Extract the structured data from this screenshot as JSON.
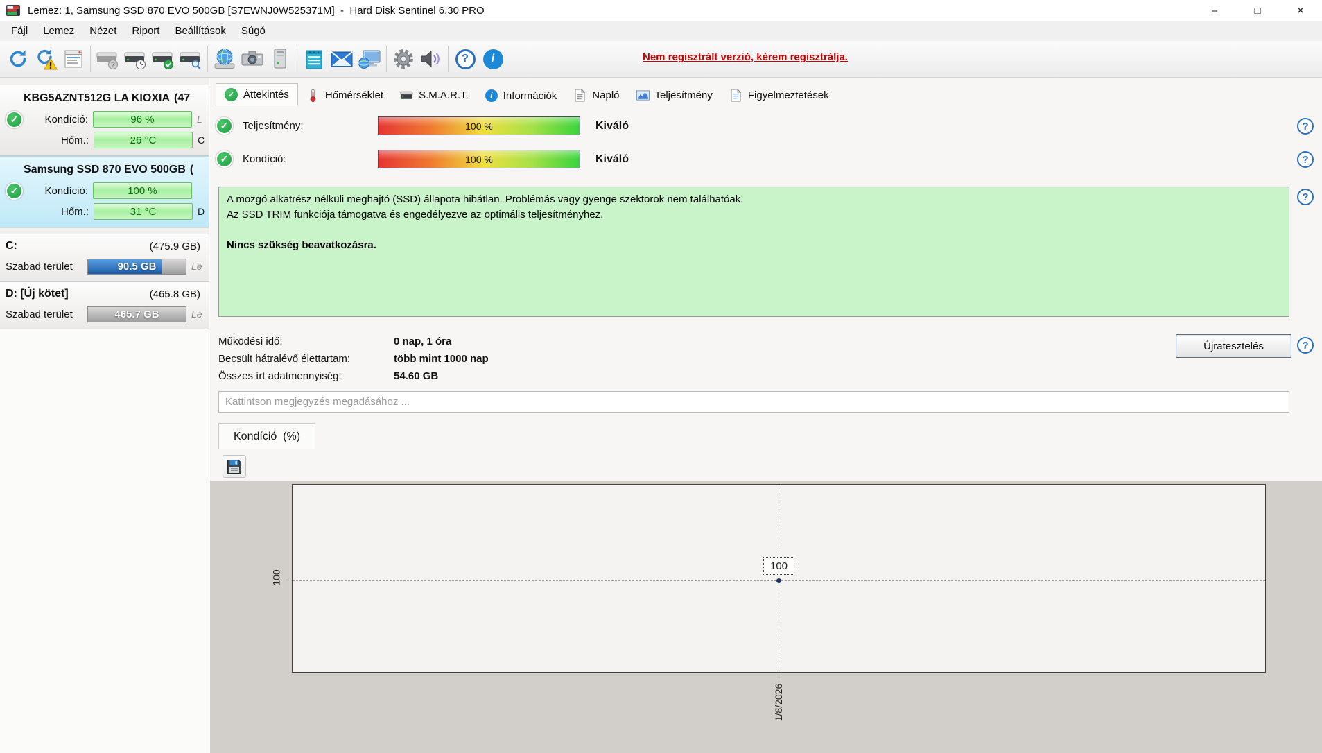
{
  "window": {
    "title": "Lemez: 1, Samsung SSD 870 EVO 500GB [S7EWNJ0W525371M]  -  Hard Disk Sentinel 6.30 PRO"
  },
  "glyphs": {
    "check": "✓",
    "help": "?",
    "info": "i",
    "minimize": "–",
    "maximize": "□",
    "close": "×"
  },
  "menu": {
    "items": [
      {
        "label": "Fájl"
      },
      {
        "label": "Lemez"
      },
      {
        "label": "Nézet"
      },
      {
        "label": "Riport"
      },
      {
        "label": "Beállítások"
      },
      {
        "label": "Súgó"
      }
    ]
  },
  "toolbar": {
    "icons": [
      "refresh-icon",
      "refresh-warning-icon",
      "report-icon",
      "disk-info-icon",
      "disk-clock-icon",
      "disk-accept-icon",
      "disk-search-icon",
      "network-globe-icon",
      "camera-icon",
      "computer-icon",
      "notes-icon",
      "email-icon",
      "web-monitor-icon",
      "settings-gear-icon",
      "sound-speaker-icon",
      "help-icon",
      "info-icon"
    ],
    "registration_notice": "Nem regisztrált verzió, kérem regisztrálja."
  },
  "sidebar": {
    "disks": [
      {
        "name": "KBG5AZNT512G LA KIOXIA",
        "size_fragment": "(47",
        "condition_label": "Kondíció:",
        "condition_value": "96 %",
        "temp_label": "Hőm.:",
        "temp_value": "26 °C",
        "fragment_row1": "L",
        "fragment_row2": "C"
      },
      {
        "name": "Samsung SSD 870 EVO 500GB",
        "size_fragment": "(",
        "condition_label": "Kondíció:",
        "condition_value": "100 %",
        "temp_label": "Hőm.:",
        "temp_value": "31 °C",
        "fragment_row1": "",
        "fragment_row2": "D"
      }
    ],
    "partitions": [
      {
        "name": "C:",
        "size": "(475.9 GB)",
        "free_label": "Szabad terület",
        "free_value": "90.5 GB",
        "used_pct": 75,
        "fragment": "Le"
      },
      {
        "name": "D: [Új kötet]",
        "size": "(465.8 GB)",
        "free_label": "Szabad terület",
        "free_value": "465.7 GB",
        "used_pct": 0,
        "fragment": "Le"
      }
    ]
  },
  "tabs": [
    {
      "label": "Áttekintés",
      "icon": "check-circle-icon"
    },
    {
      "label": "Hőmérséklet",
      "icon": "thermometer-icon"
    },
    {
      "label": "S.M.A.R.T.",
      "icon": "disk-icon"
    },
    {
      "label": "Információk",
      "icon": "info-circle-icon"
    },
    {
      "label": "Napló",
      "icon": "document-icon"
    },
    {
      "label": "Teljesítmény",
      "icon": "chart-icon"
    },
    {
      "label": "Figyelmeztetések",
      "icon": "warnings-page-icon"
    }
  ],
  "overview": {
    "performance_label": "Teljesítmény:",
    "performance_value": "100 %",
    "performance_rating": "Kiváló",
    "condition_label": "Kondíció:",
    "condition_value": "100 %",
    "condition_rating": "Kiváló",
    "status_line1": "A mozgó alkatrész nélküli meghajtó (SSD) állapota hibátlan. Problémás vagy gyenge szektorok nem találhatóak.",
    "status_line2": "Az SSD TRIM funkciója támogatva és engedélyezve az optimális teljesítményhez.",
    "status_bold": "Nincs szükség beavatkozásra.",
    "stats": [
      {
        "label": "Működési idő:",
        "value": "0 nap, 1 óra"
      },
      {
        "label": "Becsült hátralévő élettartam:",
        "value": "több mint 1000 nap"
      },
      {
        "label": "Összes írt adatmennyiség:",
        "value": "54.60 GB"
      }
    ],
    "retest_button": "Újratesztelés",
    "comment_placeholder": "Kattintson megjegyzés megadásához ..."
  },
  "chart": {
    "tab_label": "Kondíció  (%)",
    "ytick": "100",
    "xtick": "1/8/2026",
    "point_label": "100"
  },
  "chart_data": {
    "type": "line",
    "title": "Kondíció (%)",
    "x": [
      "1/8/2026"
    ],
    "series": [
      {
        "name": "Kondíció",
        "values": [
          100
        ]
      }
    ],
    "xlabel": "",
    "ylabel": "",
    "ytick_labels": [
      "100"
    ],
    "point_labels": [
      "100"
    ],
    "grid": "dashed crosshair through single data point",
    "legend": "none"
  },
  "colors": {
    "accent_blue": "#2e86d1",
    "ok_green": "#27a23d",
    "selected_disk_bg": "#cdeefb",
    "status_box_bg": "#c9f3c9",
    "registration_red": "#cc0000",
    "free_bar_fill": "#2f7fd0"
  }
}
